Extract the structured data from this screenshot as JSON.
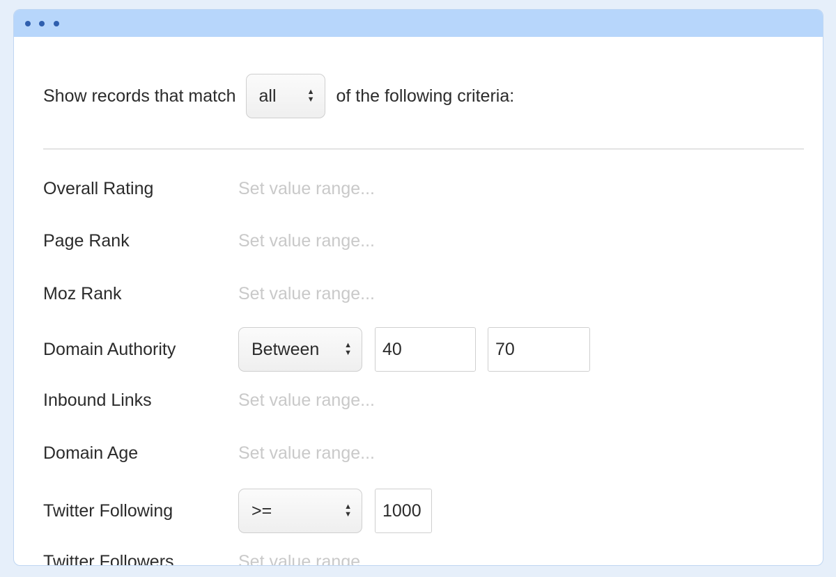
{
  "titlebar": {
    "dot_color": "#2f5fae",
    "background": "#b7d6fb"
  },
  "match": {
    "prefix": "Show records that match",
    "select_value": "all",
    "suffix": "of the following criteria:"
  },
  "criteria": [
    {
      "label": "Overall Rating",
      "placeholder": "Set value range..."
    },
    {
      "label": "Page Rank",
      "placeholder": "Set value range..."
    },
    {
      "label": "Moz Rank",
      "placeholder": "Set value range..."
    },
    {
      "label": "Domain Authority",
      "operator": "Between",
      "min": "40",
      "max": "70"
    },
    {
      "label": "Inbound Links",
      "placeholder": "Set value range..."
    },
    {
      "label": "Domain Age",
      "placeholder": "Set value range..."
    },
    {
      "label": "Twitter Following",
      "operator": ">=",
      "value": "1000"
    },
    {
      "label": "Twitter Followers",
      "placeholder": "Set value range..."
    }
  ],
  "icons": {
    "select_caret": "up-down-caret-icon"
  }
}
